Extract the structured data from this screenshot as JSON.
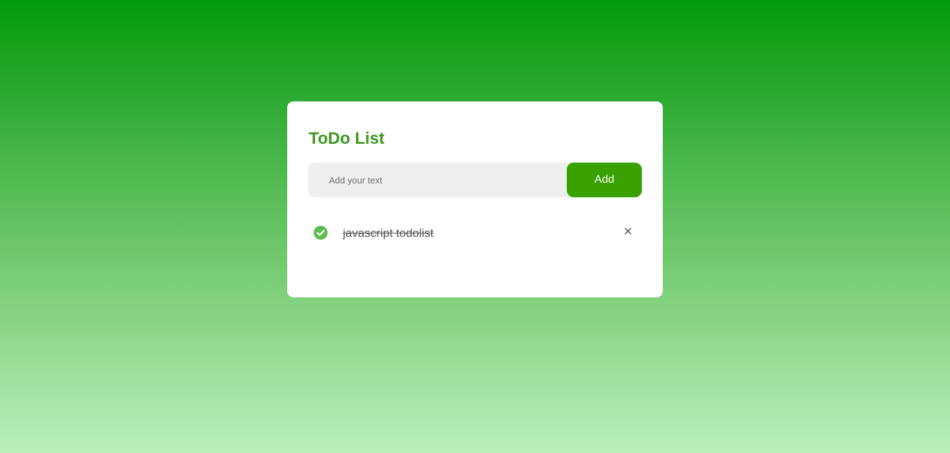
{
  "app": {
    "title": "ToDo List"
  },
  "input": {
    "value": "",
    "placeholder": "Add your text"
  },
  "add_button": {
    "label": "Add"
  },
  "todos": [
    {
      "text": "javascript todolist",
      "completed": true,
      "status_icon": "check-circle-icon",
      "delete_glyph": "×"
    }
  ],
  "colors": {
    "accent": "#3aa102",
    "title": "#3c9a1e",
    "check": "#5cbe4c",
    "background_top": "#029a09",
    "background_bottom": "#bcf0bd"
  }
}
